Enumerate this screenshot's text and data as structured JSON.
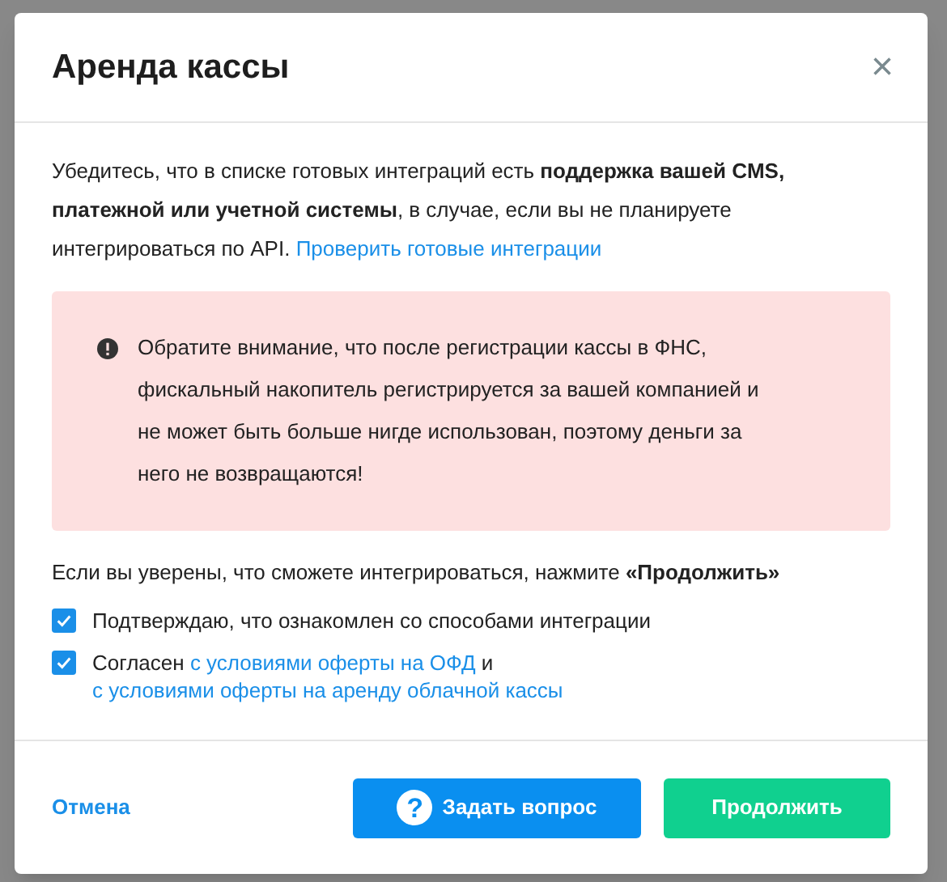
{
  "dialog": {
    "title": "Аренда кассы",
    "close": "×"
  },
  "intro": {
    "text": "Убедитесь, что в списке готовых интеграций есть **поддержка вашей CMS, платежной или учетной системы**, в случае, если вы не планируете интегрироваться по API.",
    "link": "Проверить готовые интеграции"
  },
  "alert": {
    "text": "Обратите внимание, что после регистрации кассы в ФНС, фискальный накопитель регистрируется за вашей компанией и не может быть больше нигде использован, поэтому деньги за него не возвращаются!"
  },
  "hint": "Если вы уверены, что сможете интегрироваться, нажмите **«Продолжить»**",
  "checkboxes": [
    {
      "checked": true,
      "parts": [
        {
          "kind": "text",
          "text": "Подтверждаю, что ознакомлен со способами интеграции"
        }
      ]
    },
    {
      "checked": true,
      "parts": [
        {
          "kind": "text",
          "text": "Согласен"
        },
        {
          "kind": "link",
          "text": "с условиями оферты на ОФД"
        },
        {
          "kind": "text",
          "text": "и"
        },
        {
          "kind": "link",
          "text": "с условиями оферты на аренду облачной кассы"
        }
      ]
    }
  ],
  "footer": {
    "cancel": "Отмена",
    "ask": "Задать вопрос",
    "ask_icon": "?",
    "continue": "Продолжить"
  }
}
